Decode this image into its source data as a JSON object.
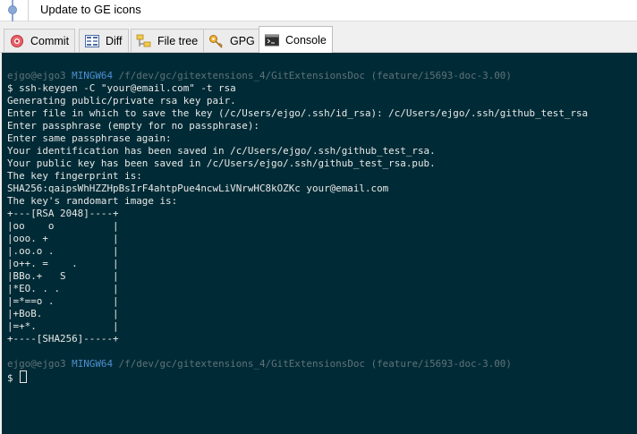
{
  "commit": {
    "message": "Update to GE icons"
  },
  "tabs": [
    {
      "label": "Commit",
      "icon": "commit-icon"
    },
    {
      "label": "Diff",
      "icon": "diff-icon"
    },
    {
      "label": "File tree",
      "icon": "file-tree-icon"
    },
    {
      "label": "GPG",
      "icon": "key-icon"
    },
    {
      "label": "Console",
      "icon": "console-icon",
      "active": true
    }
  ],
  "console": {
    "prompt1": {
      "host": "ejgo@ejgo3",
      "env": "MINGW64",
      "path": "/f/dev/gc/gitextensions_4/GitExtensionsDoc",
      "branch": "(feature/i5693-doc-3.00)"
    },
    "lines": [
      "$ ssh-keygen -C \"your@email.com\" -t rsa",
      "Generating public/private rsa key pair.",
      "Enter file in which to save the key (/c/Users/ejgo/.ssh/id_rsa): /c/Users/ejgo/.ssh/github_test_rsa",
      "Enter passphrase (empty for no passphrase):",
      "Enter same passphrase again:",
      "Your identification has been saved in /c/Users/ejgo/.ssh/github_test_rsa.",
      "Your public key has been saved in /c/Users/ejgo/.ssh/github_test_rsa.pub.",
      "The key fingerprint is:",
      "SHA256:qaipsWhHZZHpBsIrF4ahtpPue4ncwLiVNrwHC8kOZKc your@email.com",
      "The key's randomart image is:",
      "+---[RSA 2048]----+",
      "|oo    o          |",
      "|ooo. +           |",
      "|.oo.o .          |",
      "|o++. =    .      |",
      "|BBo.+   S        |",
      "|*EO. . .         |",
      "|=*==o .          |",
      "|+BoB.            |",
      "|=+*.             |",
      "+----[SHA256]-----+"
    ],
    "prompt2": {
      "host": "ejgo@ejgo3",
      "env": "MINGW64",
      "path": "/f/dev/gc/gitextensions_4/GitExtensionsDoc",
      "branch": "(feature/i5693-doc-3.00)"
    },
    "input_prompt": "$"
  },
  "colors": {
    "console_bg": "#002b36",
    "console_fg": "#e8e8e8",
    "mingw_blue": "#4f8fd0",
    "prompt_gray": "#5f727a"
  }
}
